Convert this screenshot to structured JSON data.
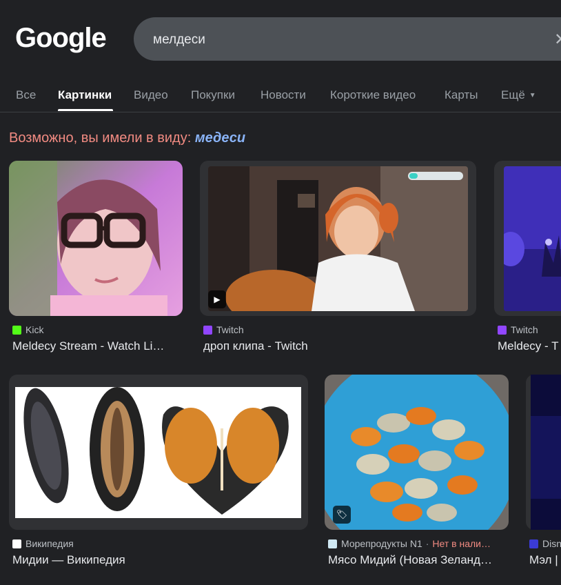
{
  "logo": "Google",
  "search": {
    "query": "мелдеси",
    "clear_icon": "close-icon"
  },
  "tabs": [
    {
      "label": "Все"
    },
    {
      "label": "Картинки",
      "active": true
    },
    {
      "label": "Видео"
    },
    {
      "label": "Покупки"
    },
    {
      "label": "Новости"
    },
    {
      "label": "Короткие видео"
    },
    {
      "label": "Карты"
    },
    {
      "label": "Ещё"
    }
  ],
  "did_you_mean": {
    "prefix": "Возможно, вы имели в виду:",
    "suggestion": "медеси"
  },
  "results": [
    {
      "source": "Kick",
      "title": "Meldecy Stream - Watch Li…",
      "favicon_color": "#53fc18",
      "icon": "kick-icon"
    },
    {
      "source": "Twitch",
      "title": "дроп клипа - Twitch",
      "favicon_color": "#9146ff",
      "icon": "twitch-icon",
      "badge": "play-icon"
    },
    {
      "source": "Twitch",
      "title": "Meldecy - T",
      "favicon_color": "#9146ff",
      "icon": "twitch-icon"
    },
    {
      "source": "Википедия",
      "title": "Мидии — Википедия",
      "favicon_color": "#ffffff",
      "icon": "wikipedia-icon"
    },
    {
      "source": "Морепродукты N1",
      "stock": "Нет в нали…",
      "title": "Мясо Мидий (Новая Зеланд…",
      "favicon_color": "#cfe8f3",
      "icon": "store-icon",
      "badge": "tag-icon"
    },
    {
      "source": "Disn",
      "title": "Мэл |",
      "favicon_color": "#3b3bd6",
      "icon": "site-icon"
    }
  ]
}
